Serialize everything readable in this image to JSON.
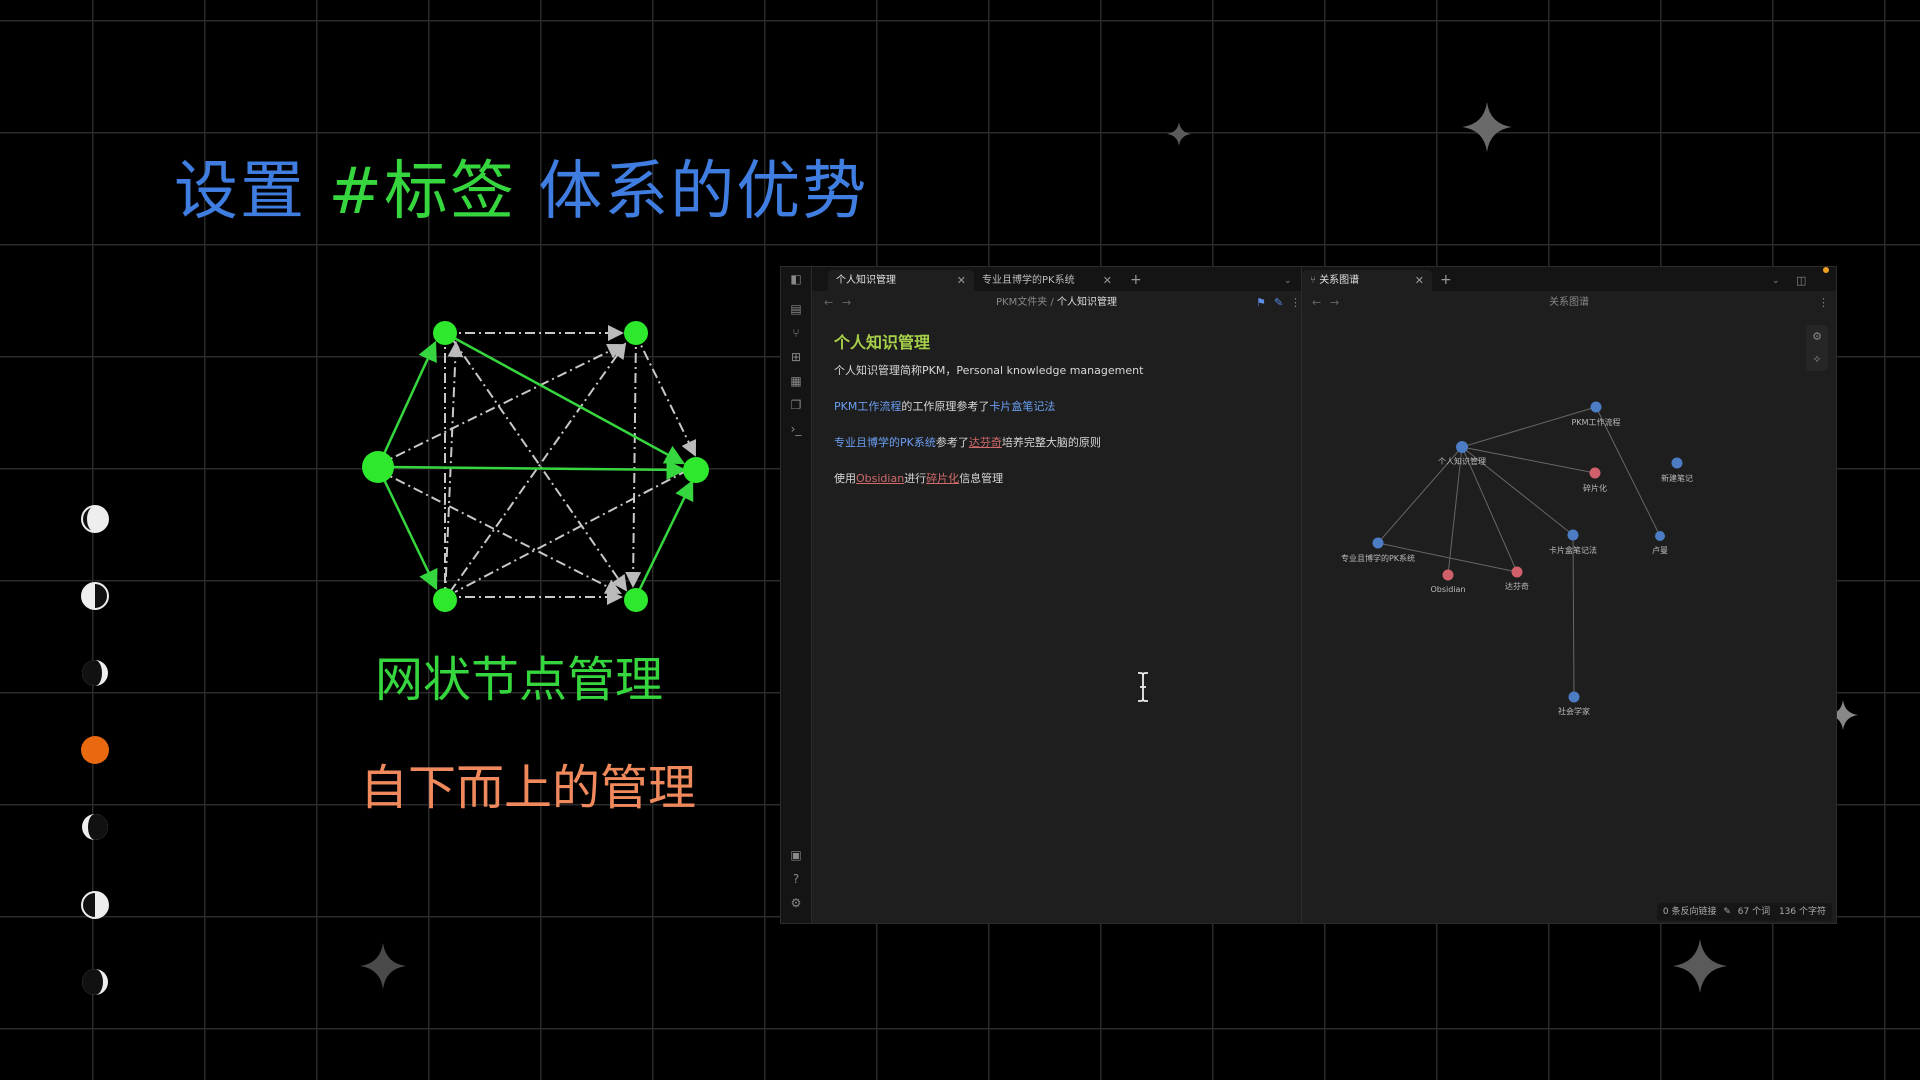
{
  "slide": {
    "title_part1": "设置 ",
    "title_part2": "#标签",
    "title_part3": " 体系的优势",
    "caption_network": "网状节点管理",
    "caption_bottomup": "自下而上的管理",
    "colors": {
      "title_blue": "#3f7ee0",
      "green": "#36d63e",
      "orange": "#f08a5d",
      "moon_active": "#e8690f"
    }
  },
  "moons": [
    {
      "phase": "first-quarter-icon"
    },
    {
      "phase": "half-moon-icon"
    },
    {
      "phase": "waxing-gibbous-icon"
    },
    {
      "phase": "full-orange-icon",
      "active": true
    },
    {
      "phase": "waning-gibbous-icon"
    },
    {
      "phase": "half-moon-right-icon"
    },
    {
      "phase": "last-quarter-icon"
    }
  ],
  "app": {
    "left_pane": {
      "tabs": [
        {
          "label": "个人知识管理",
          "active": true
        },
        {
          "label": "专业且博学的PK系统",
          "active": false
        }
      ],
      "breadcrumb_folder": "PKM文件夹",
      "breadcrumb_sep": "/",
      "breadcrumb_current": "个人知识管理",
      "note": {
        "title": "个人知识管理",
        "line1": "个人知识管理简称PKM，Personal knowledge management",
        "line2": {
          "link1": "PKM工作流程",
          "text1": "的工作原理参考了",
          "link2": "卡片盒笔记法"
        },
        "line3": {
          "link1": "专业且博学的PK系统",
          "text1": "参考了",
          "link2": "达芬奇",
          "text2": "培养完整大脑的原则"
        },
        "line4": {
          "text0": "使用",
          "link1": "Obsidian",
          "text1": "进行",
          "link2": "碎片化",
          "text2": "信息管理"
        }
      }
    },
    "right_pane": {
      "tab_label": "关系图谱",
      "header_title": "关系图谱",
      "graph_nodes": [
        {
          "label": "PKM工作流程"
        },
        {
          "label": "个人知识管理"
        },
        {
          "label": "碎片化"
        },
        {
          "label": "新建笔记"
        },
        {
          "label": "卡片盒笔记法"
        },
        {
          "label": "卢曼"
        },
        {
          "label": "专业且博学的PK系统"
        },
        {
          "label": "Obsidian"
        },
        {
          "label": "达芬奇"
        },
        {
          "label": "社会学家"
        }
      ]
    },
    "status": {
      "backlinks": "0 条反向链接",
      "words": "67 个词",
      "chars": "136 个字符"
    }
  }
}
